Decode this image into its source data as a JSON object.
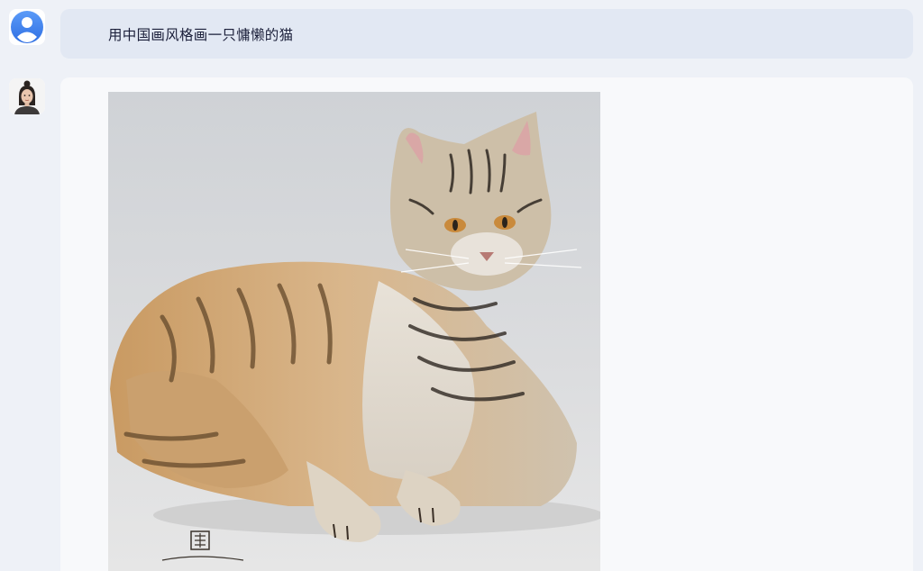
{
  "chat": {
    "user_message": "用中国画风格画一只慵懒的猫",
    "user_avatar_icon": "user-avatar-icon",
    "bot_avatar_icon": "assistant-portrait-avatar",
    "response_image_subject": "tabby-cat-painting"
  },
  "colors": {
    "page_background": "#eef1f7",
    "user_bubble": "#e2e8f3",
    "bot_bubble": "#f8f9fb",
    "avatar_accent": "#4a8af4",
    "text": "#1b1f3a"
  }
}
